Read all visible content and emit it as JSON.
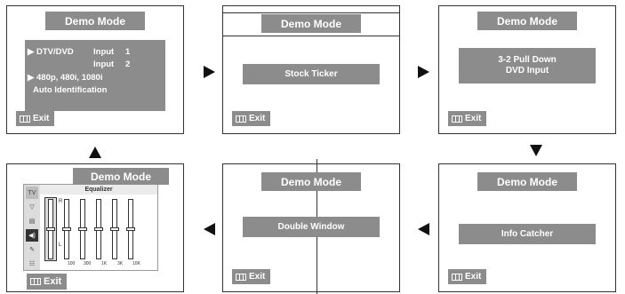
{
  "common": {
    "title": "Demo Mode",
    "exit_label": "Exit"
  },
  "screen1": {
    "line1_arrow": "▶",
    "line1_text": "DTV/DVD",
    "input1_label": "Input",
    "input1_num": "1",
    "input2_label": "Input",
    "input2_num": "2",
    "line3_arrow": "▶",
    "line3_text": "480p, 480i, 1080i",
    "line4_text": "Auto Identification"
  },
  "screen2": {
    "box": "Stock Ticker"
  },
  "screen3": {
    "box_line1": "3-2 Pull Down",
    "box_line2": "DVD Input"
  },
  "screen4": {
    "side_label": "TV",
    "eq_title": "Equalizer",
    "r_label": "R",
    "l_label": "L",
    "ticks": [
      "100",
      "300",
      "1K",
      "3K",
      "10K"
    ]
  },
  "screen5": {
    "box": "Double Window"
  },
  "screen6": {
    "box": "Info Catcher"
  },
  "eq_levels": [
    0.5,
    0.5,
    0.5,
    0.5,
    0.5,
    0.5
  ]
}
